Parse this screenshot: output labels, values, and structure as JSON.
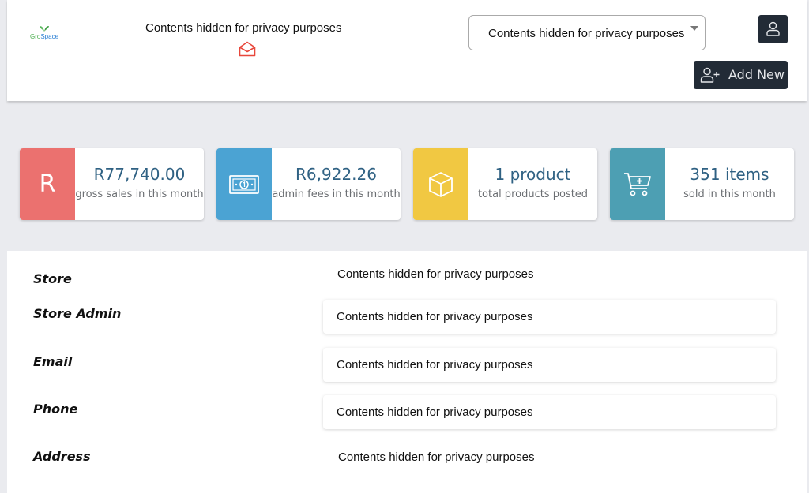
{
  "header": {
    "logo": {
      "part1": "Gro",
      "part2": "Space"
    },
    "store_title": "Contents hidden for privacy purposes",
    "store_select_value": "Contents hidden for privacy purposes",
    "add_new_label": "Add New"
  },
  "stats": [
    {
      "icon": "R",
      "value": "R77,740.00",
      "label": "gross sales in this month",
      "color": "#eb716f"
    },
    {
      "icon": "money-icon",
      "value": "R6,922.26",
      "label": "admin fees in this month",
      "color": "#4ba3d3"
    },
    {
      "icon": "box-icon",
      "value": "1 product",
      "label": "total products posted",
      "color": "#f1c842"
    },
    {
      "icon": "cart-icon",
      "value": "351 items",
      "label": "sold in this month",
      "color": "#4d9fb3"
    }
  ],
  "details": {
    "store": {
      "label": "Store",
      "value": "Contents hidden for privacy purposes"
    },
    "store_admin": {
      "label": "Store Admin",
      "value": "Contents hidden for privacy purposes"
    },
    "email": {
      "label": "Email",
      "value": "Contents hidden for privacy purposes"
    },
    "phone": {
      "label": "Phone",
      "value": "Contents hidden for privacy purposes"
    },
    "address": {
      "label": "Address",
      "value": "Contents hidden for privacy purposes"
    }
  }
}
